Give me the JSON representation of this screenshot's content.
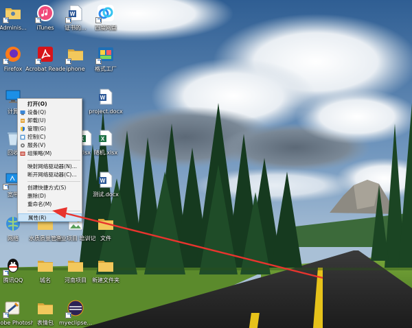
{
  "desktop_icons": [
    {
      "label": "Adminis...",
      "icon": "user-folder-icon"
    },
    {
      "label": "iTunes",
      "icon": "itunes-icon"
    },
    {
      "label": "证书的...",
      "icon": "word-document-icon"
    },
    {
      "label": "百度网盘",
      "icon": "baidu-netdisk-icon"
    },
    {
      "label": "Firefox",
      "icon": "firefox-icon"
    },
    {
      "label": "Acrobat Reader DC",
      "icon": "acrobat-icon"
    },
    {
      "label": "iphone",
      "icon": "folder-icon"
    },
    {
      "label": "格式工厂",
      "icon": "format-factory-icon"
    },
    {
      "label": "计算",
      "icon": "computer-icon"
    },
    {
      "label": "project.docx",
      "icon": "word-document-icon"
    },
    {
      "label": "回收",
      "icon": "recycle-bin-icon"
    },
    {
      "label": "xlsx",
      "icon": "excel-document-icon"
    },
    {
      "label": "随机.xlsx",
      "icon": "excel-document-icon"
    },
    {
      "label": "宽带",
      "icon": "broadband-icon"
    },
    {
      "label": "测试.docx",
      "icon": "word-document-icon"
    },
    {
      "label": "网络",
      "icon": "network-icon"
    },
    {
      "label": "水质质量管理",
      "icon": "folder-icon"
    },
    {
      "label": "渔业项目 培训记录.jpg",
      "icon": "image-icon"
    },
    {
      "label": "文件",
      "icon": "folder-icon"
    },
    {
      "label": "腾讯QQ",
      "icon": "qq-icon"
    },
    {
      "label": "城名",
      "icon": "folder-icon"
    },
    {
      "label": "河南项目",
      "icon": "folder-icon"
    },
    {
      "label": "新建文件夹",
      "icon": "folder-icon"
    },
    {
      "label": "Adobe Photosh...",
      "icon": "photoshop-icon"
    },
    {
      "label": "表情包",
      "icon": "folder-icon"
    },
    {
      "label": "myeclipse...",
      "icon": "eclipse-icon"
    }
  ],
  "context_menu": {
    "items": [
      {
        "label": "打开(O)",
        "bold": true
      },
      {
        "label": "设备(Q)",
        "icon": "device-icon"
      },
      {
        "label": "卸载(U)",
        "icon": "uninstall-icon"
      },
      {
        "label": "管理(G)",
        "icon": "shield-icon"
      },
      {
        "label": "控制(C)",
        "icon": "control-icon"
      },
      {
        "label": "服务(V)",
        "icon": "gear-icon"
      },
      {
        "label": "组策略(M)",
        "icon": "policy-icon"
      },
      {
        "label": "映射网络驱动器(N)..."
      },
      {
        "label": "断开网络驱动器(C)..."
      },
      {
        "label": "创建快捷方式(S)"
      },
      {
        "label": "删除(D)"
      },
      {
        "label": "重命名(M)"
      },
      {
        "label": "属性(R)",
        "highlighted": true
      }
    ]
  },
  "colors": {
    "menu_background": "#f2f2f2",
    "menu_highlight": "#cce4f7",
    "annotation_arrow": "#e8342e"
  }
}
